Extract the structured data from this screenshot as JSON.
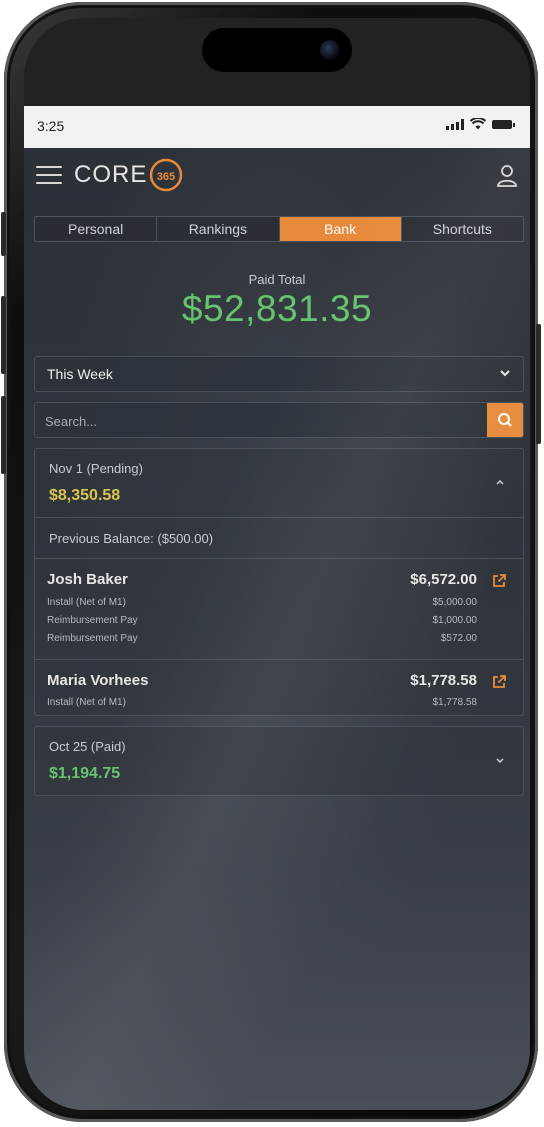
{
  "status": {
    "time": "3:25"
  },
  "header": {
    "logo_text": "CORE",
    "logo_badge": "365"
  },
  "tabs": [
    {
      "label": "Personal",
      "active": false
    },
    {
      "label": "Rankings",
      "active": false
    },
    {
      "label": "Bank",
      "active": true
    },
    {
      "label": "Shortcuts",
      "active": false
    }
  ],
  "summary": {
    "label": "Paid Total",
    "value": "$52,831.35"
  },
  "period_select": {
    "value": "This Week"
  },
  "search": {
    "placeholder": "Search..."
  },
  "payouts": [
    {
      "title": "Nov 1 (Pending)",
      "amount": "$8,350.58",
      "status": "pending",
      "expanded": true,
      "previous_balance": "Previous Balance: ($500.00)",
      "entries": [
        {
          "name": "Josh Baker",
          "total": "$6,572.00",
          "lines": [
            {
              "label": "Install (Net of M1)",
              "value": "$5,000.00"
            },
            {
              "label": "Reimbursement Pay",
              "value": "$1,000.00"
            },
            {
              "label": "Reimbursement Pay",
              "value": "$572.00"
            }
          ]
        },
        {
          "name": "Maria Vorhees",
          "total": "$1,778.58",
          "lines": [
            {
              "label": "Install (Net of M1)",
              "value": "$1,778.58"
            }
          ]
        }
      ]
    },
    {
      "title": "Oct 25 (Paid)",
      "amount": "$1,194.75",
      "status": "paid",
      "expanded": false
    }
  ],
  "colors": {
    "accent": "#e88a3c",
    "positive": "#66c46f",
    "pending": "#d9c44d",
    "background": "#2c3037"
  }
}
